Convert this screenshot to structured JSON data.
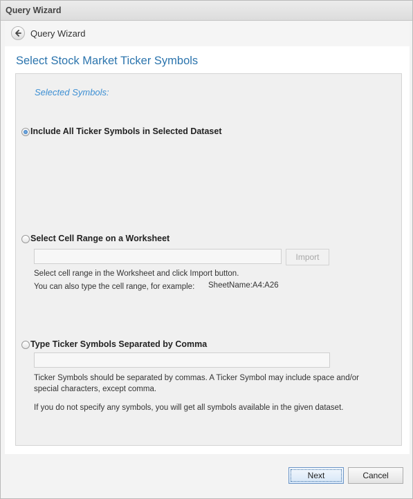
{
  "window": {
    "title": "Query Wizard"
  },
  "nav": {
    "title": "Query Wizard",
    "back_icon": "back-arrow-icon"
  },
  "page": {
    "heading": "Select Stock Market Ticker Symbols",
    "section_label": "Selected Symbols:"
  },
  "options": {
    "all": {
      "label": "Include All Ticker Symbols in Selected Dataset",
      "checked": true
    },
    "range": {
      "label": "Select Cell Range on a Worksheet",
      "checked": false,
      "input_value": "",
      "import_label": "Import",
      "help1": "Select cell range in the Worksheet and click Import button.",
      "help2": "You can also type the cell range, for example:",
      "example": "SheetName:A4:A26"
    },
    "type": {
      "label": "Type Ticker Symbols Separated by Comma",
      "checked": false,
      "input_value": "",
      "help1": "Ticker Symbols should be separated by commas. A Ticker Symbol may include space and/or special characters, except comma.",
      "help2": "If you do not specify any symbols, you will get all symbols available in the given dataset."
    }
  },
  "footer": {
    "next_label": "Next",
    "cancel_label": "Cancel"
  },
  "colors": {
    "heading": "#2b74ad",
    "section_label": "#3d8fd3",
    "radio_selected": "#2c6bb3"
  }
}
